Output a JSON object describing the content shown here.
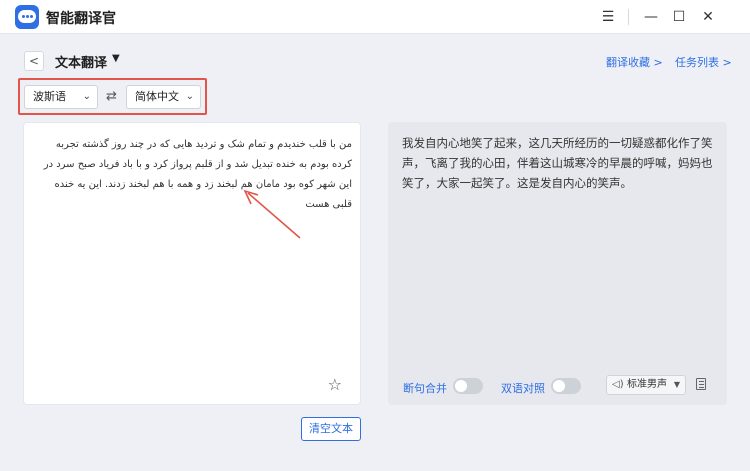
{
  "app": {
    "title": "智能翻译官"
  },
  "window_controls": {
    "menu": "☰",
    "minimize": "—",
    "maximize": "☐",
    "close": "✕"
  },
  "header": {
    "back": "<",
    "title": "文本翻译",
    "title_caret": "▼",
    "links": {
      "favorites": "翻译收藏 >",
      "tasks": "任务列表 >"
    }
  },
  "languages": {
    "source": "波斯语",
    "target": "简体中文",
    "chevron": "⌄",
    "swap": "⇄"
  },
  "source_text": "من با قلب خندیدم و تمام شک و تردید هایی که در چند روز گذشته تجربه کرده بودم به خنده تبدیل شد و از قلبم پرواز کرد و با باد فریاد صبح سرد در این شهر کوه بود مامان هم لبخند زد و همه با هم لبخند زدند. این یه خنده قلبی هست",
  "target_text": "我发自内心地笑了起来，这几天所经历的一切疑惑都化作了笑声，飞离了我的心田，伴着这山城寒冷的早晨的呼喊，妈妈也笑了，大家一起笑了。这是发自内心的笑声。",
  "options": {
    "merge": "断句合并",
    "bilingual": "双语对照"
  },
  "voice": {
    "label": "标准男声",
    "speaker": "◁)",
    "chevron": "▼"
  },
  "icons": {
    "star": "☆",
    "annotation": "red-arrow"
  },
  "buttons": {
    "clear": "清空文本"
  },
  "colors": {
    "accent": "#2f6fe4",
    "highlight": "#e2554b"
  }
}
